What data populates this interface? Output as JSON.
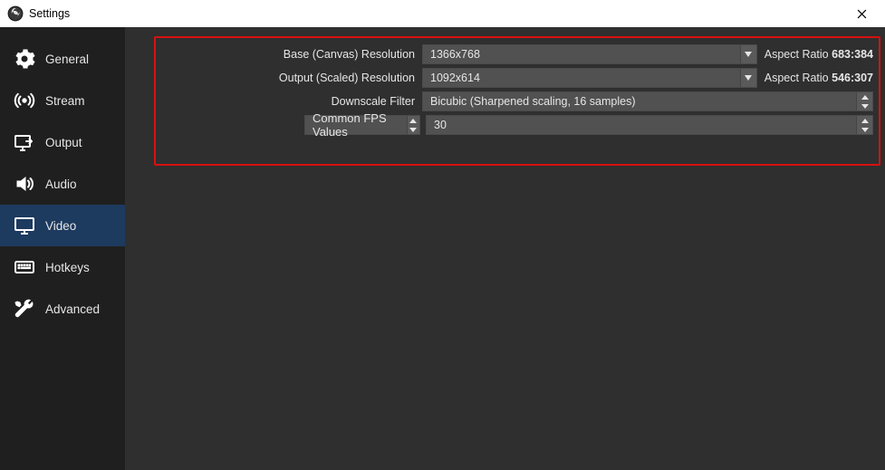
{
  "window": {
    "title": "Settings"
  },
  "sidebar": {
    "items": [
      {
        "label": "General"
      },
      {
        "label": "Stream"
      },
      {
        "label": "Output"
      },
      {
        "label": "Audio"
      },
      {
        "label": "Video"
      },
      {
        "label": "Hotkeys"
      },
      {
        "label": "Advanced"
      }
    ],
    "active_index": 4
  },
  "video": {
    "base_label": "Base (Canvas) Resolution",
    "base_value": "1366x768",
    "base_aspect_label": "Aspect Ratio",
    "base_aspect_value": "683:384",
    "output_label": "Output (Scaled) Resolution",
    "output_value": "1092x614",
    "output_aspect_label": "Aspect Ratio",
    "output_aspect_value": "546:307",
    "filter_label": "Downscale Filter",
    "filter_value": "Bicubic (Sharpened scaling, 16 samples)",
    "fps_mode_label": "Common FPS Values",
    "fps_value": "30"
  }
}
